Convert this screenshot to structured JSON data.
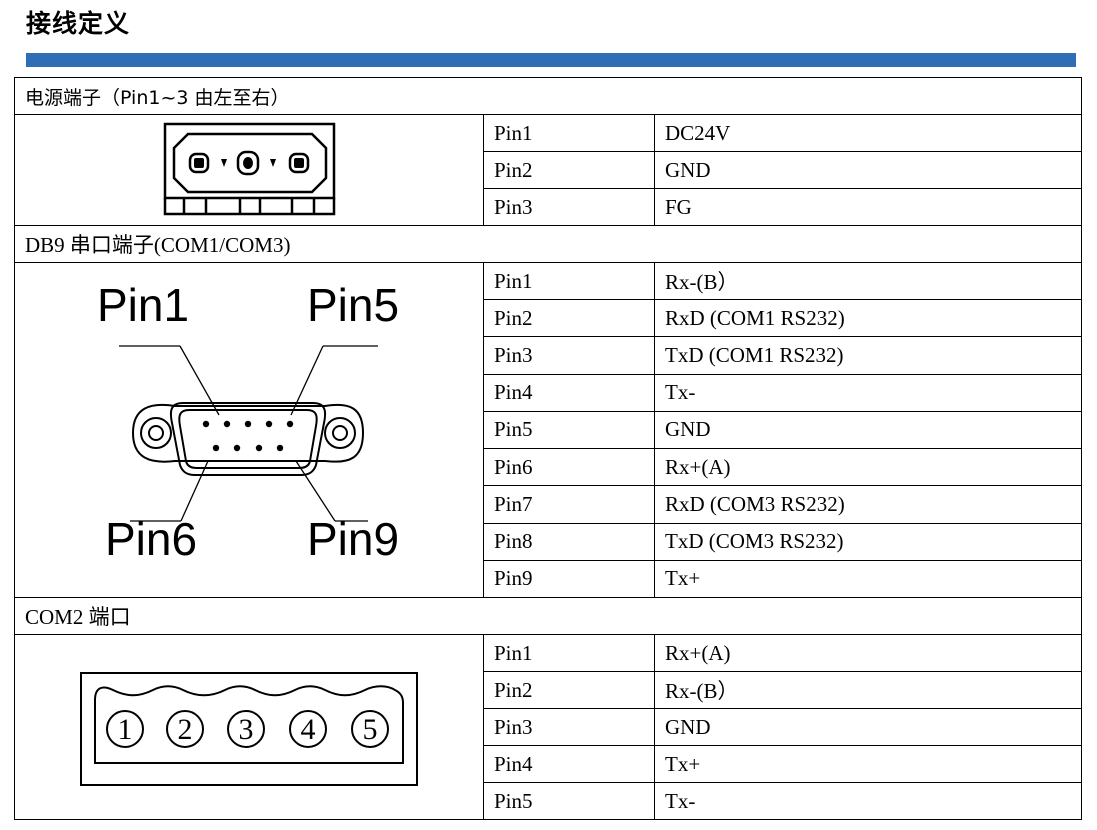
{
  "page_title": "接线定义",
  "power": {
    "heading": "电源端子（Pin1~3 由左至右）",
    "pins": [
      {
        "pin": "Pin1",
        "signal": "DC24V"
      },
      {
        "pin": "Pin2",
        "signal": "GND"
      },
      {
        "pin": "Pin3",
        "signal": "FG"
      }
    ]
  },
  "db9": {
    "heading": "DB9 串口端子(COM1/COM3)",
    "diagram_labels": {
      "tl": "Pin1",
      "tr": "Pin5",
      "bl": "Pin6",
      "br": "Pin9"
    },
    "pins": [
      {
        "pin": "Pin1",
        "signal": "Rx-(B）"
      },
      {
        "pin": "Pin2",
        "signal": "RxD (COM1 RS232)"
      },
      {
        "pin": "Pin3",
        "signal": "TxD (COM1 RS232)"
      },
      {
        "pin": "Pin4",
        "signal": "Tx-"
      },
      {
        "pin": "Pin5",
        "signal": "GND"
      },
      {
        "pin": "Pin6",
        "signal": "Rx+(A)"
      },
      {
        "pin": "Pin7",
        "signal": "RxD (COM3 RS232)"
      },
      {
        "pin": "Pin8",
        "signal": "TxD (COM3 RS232)"
      },
      {
        "pin": "Pin9",
        "signal": "Tx+"
      }
    ]
  },
  "com2": {
    "heading": "COM2 端口",
    "diagram_labels": [
      "1",
      "2",
      "3",
      "4",
      "5"
    ],
    "pins": [
      {
        "pin": "Pin1",
        "signal": "Rx+(A)"
      },
      {
        "pin": "Pin2",
        "signal": "Rx-(B）"
      },
      {
        "pin": "Pin3",
        "signal": "GND"
      },
      {
        "pin": "Pin4",
        "signal": "Tx+"
      },
      {
        "pin": "Pin5",
        "signal": "Tx-"
      }
    ]
  }
}
